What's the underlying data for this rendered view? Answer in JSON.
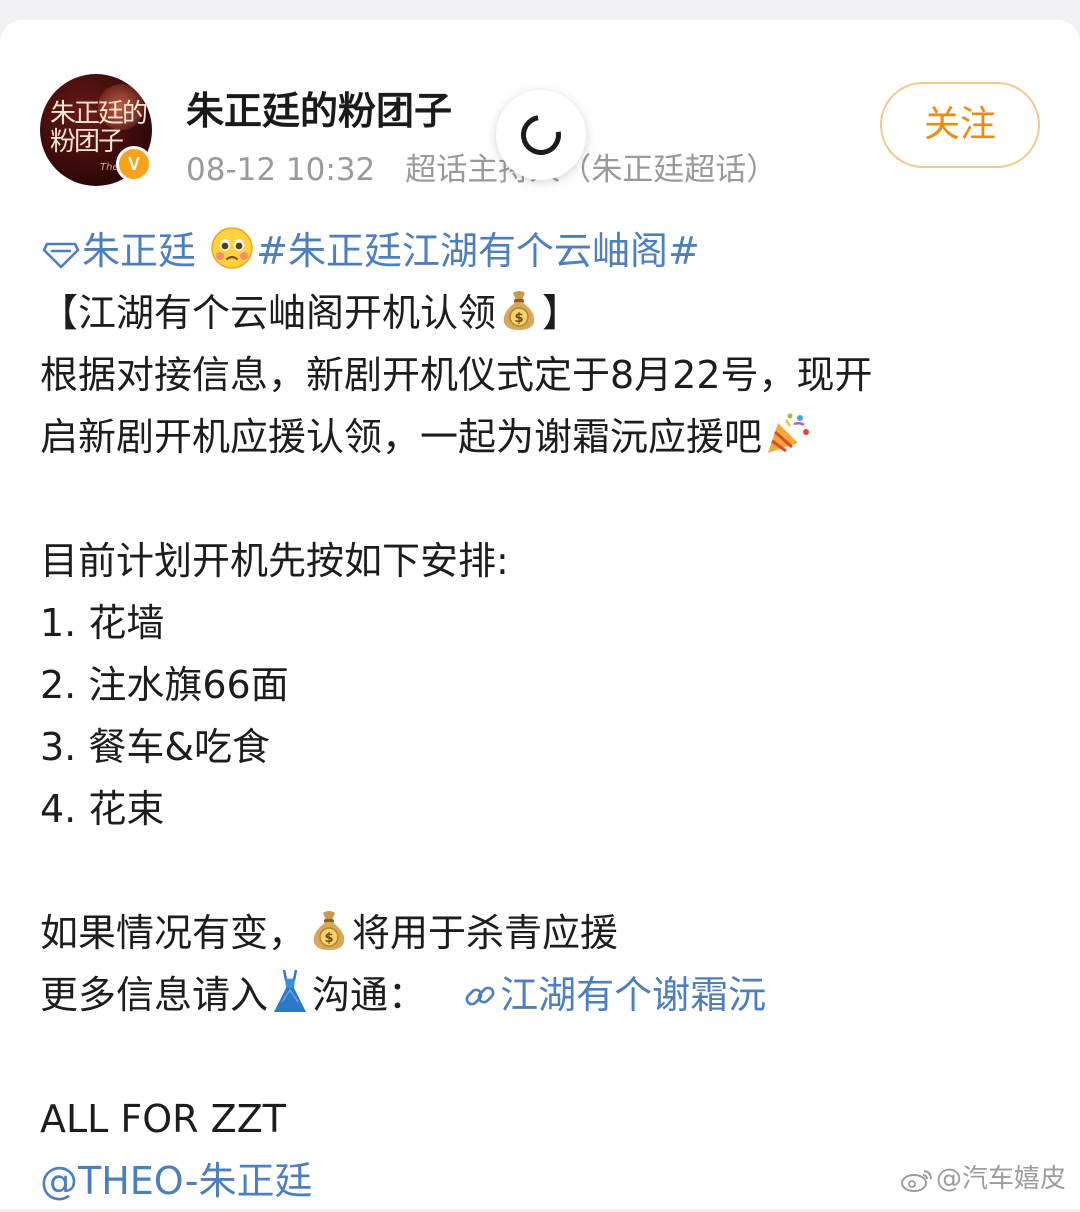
{
  "post": {
    "author": "朱正廷的粉团子",
    "time": "08-12 10:32",
    "source": "超话主持人（朱正廷超话）",
    "follow_label": "关注",
    "avatar_text": "朱正廷的粉团子",
    "avatar_sub": "Theo",
    "verified_badge": "V"
  },
  "content": {
    "tag_super": "朱正廷",
    "tag_topic": "#朱正廷江湖有个云岫阁#",
    "title": "【江湖有个云岫阁开机认领",
    "title_end": "】",
    "para1_line1": "根据对接信息，新剧开机仪式定于8月22号，现开",
    "para1_line2": "启新剧开机应援认领，一起为谢霜沅应援吧",
    "plan_heading": "目前计划开机先按如下安排:",
    "plan_items": [
      "1. 花墙",
      "2. 注水旗66面",
      "3. 餐车&吃食",
      "4. 花束"
    ],
    "change_pre": "如果情况有变，",
    "change_post": "将用于杀青应援",
    "more_pre": "更多信息请入",
    "more_mid": "沟通：",
    "more_link": "江湖有个谢霜沅",
    "slogan": "ALL FOR ZZT",
    "mention": "@THEO-朱正廷"
  },
  "watermark": "@汽车嬉皮",
  "icons": {
    "super_topic": "diamond-icon",
    "pleading_face": "pleading-face-emoji",
    "money_bag": "money-bag-emoji",
    "party_popper": "party-popper-emoji",
    "dress": "dress-emoji",
    "link": "link-icon",
    "loading": "loading-spinner-icon"
  }
}
